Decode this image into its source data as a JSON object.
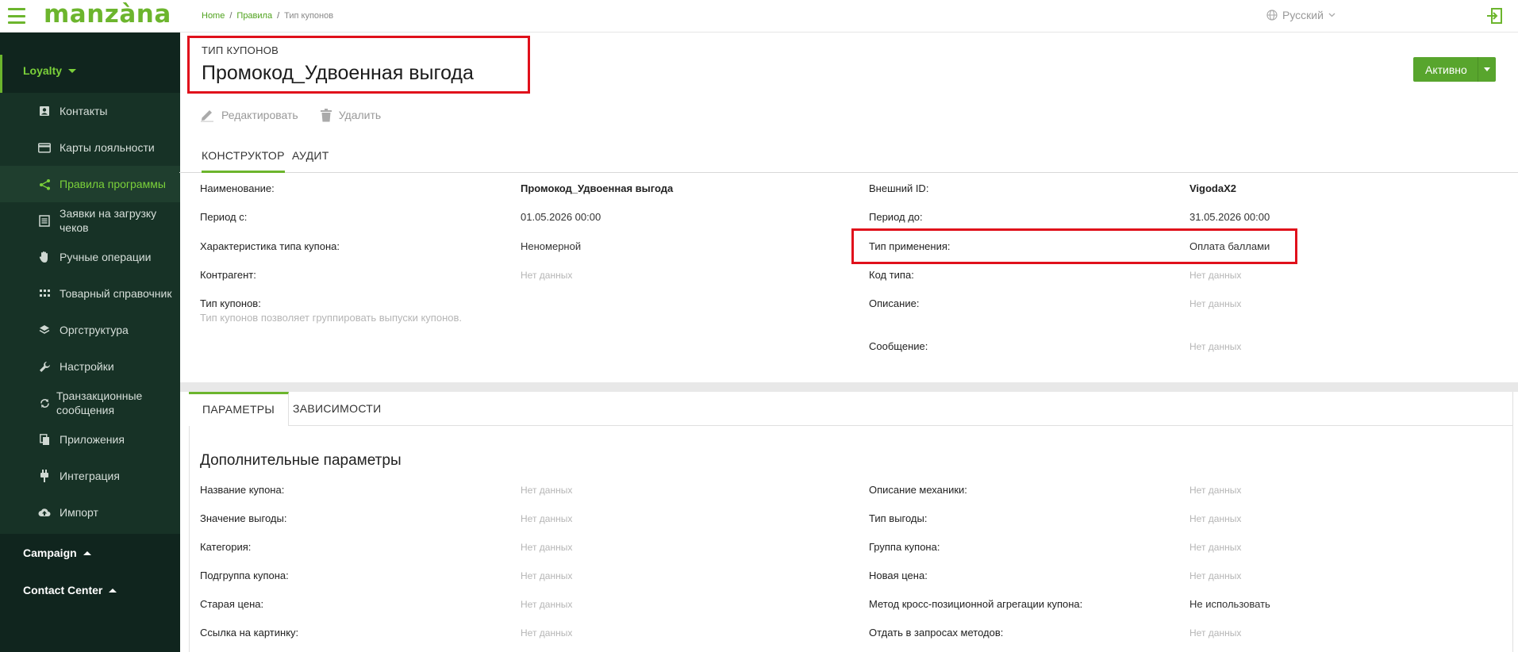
{
  "app": {
    "logo": "manzàna",
    "breadcrumb": {
      "home": "Home",
      "sep1": "/",
      "rules": "Правила",
      "sep2": "/",
      "current": "Тип купонов"
    },
    "language": "Русский"
  },
  "sidebar": {
    "loyalty": "Loyalty",
    "items": [
      {
        "label": "Контакты",
        "icon": "contact-card-icon"
      },
      {
        "label": "Карты лояльности",
        "icon": "credit-card-icon"
      },
      {
        "label": "Правила программы",
        "icon": "share-nodes-icon"
      },
      {
        "label": "Заявки на загрузку чеков",
        "icon": "receipt-list-icon"
      },
      {
        "label": "Ручные операции",
        "icon": "hand-icon"
      },
      {
        "label": "Товарный справочник",
        "icon": "grid-icon"
      },
      {
        "label": "Оргструктура",
        "icon": "layers-icon"
      },
      {
        "label": "Настройки",
        "icon": "wrench-icon"
      },
      {
        "label": "Транзакционные сообщения",
        "icon": "sync-icon"
      },
      {
        "label": "Приложения",
        "icon": "files-icon"
      },
      {
        "label": "Интеграция",
        "icon": "plug-icon"
      },
      {
        "label": "Импорт",
        "icon": "cloud-upload-icon"
      }
    ],
    "campaign": "Campaign",
    "contact_center": "Contact Center"
  },
  "header": {
    "type_label": "ТИП КУПОНОВ",
    "title": "Промокод_Удвоенная выгода",
    "status": "Активно"
  },
  "actions": {
    "edit": "Редактировать",
    "delete": "Удалить"
  },
  "tabs": {
    "constructor": "КОНСТРУКТОР",
    "audit": "АУДИТ"
  },
  "details": {
    "name_label": "Наименование:",
    "name_value": "Промокод_Удвоенная выгода",
    "period_from_label": "Период с:",
    "period_from_value": "01.05.2026 00:00",
    "char_label": "Характеристика типа купона:",
    "char_value": "Неномерной",
    "counterparty_label": "Контрагент:",
    "counterparty_value": "Нет данных",
    "coupon_type_label": "Тип купонов:",
    "coupon_type_hint": "Тип купонов позволяет группировать выпуски купонов.",
    "external_id_label": "Внешний ID:",
    "external_id_value": "VigodaX2",
    "period_to_label": "Период до:",
    "period_to_value": "31.05.2026 00:00",
    "apply_type_label": "Тип применения:",
    "apply_type_value": "Оплата баллами",
    "type_code_label": "Код типа:",
    "type_code_value": "Нет данных",
    "description_label": "Описание:",
    "description_value": "Нет данных",
    "message_label": "Сообщение:",
    "message_value": "Нет данных"
  },
  "tabs2": {
    "params": "ПАРАМЕТРЫ",
    "deps": "ЗАВИСИМОСТИ"
  },
  "params": {
    "section_title": "Дополнительные параметры",
    "left": [
      {
        "label": "Название купона:",
        "value": "Нет данных"
      },
      {
        "label": "Значение выгоды:",
        "value": "Нет данных"
      },
      {
        "label": "Категория:",
        "value": "Нет данных"
      },
      {
        "label": "Подгруппа купона:",
        "value": "Нет данных"
      },
      {
        "label": "Старая цена:",
        "value": "Нет данных"
      },
      {
        "label": "Ссылка на картинку:",
        "value": "Нет данных"
      }
    ],
    "right": [
      {
        "label": "Описание механики:",
        "value": "Нет данных"
      },
      {
        "label": "Тип выгоды:",
        "value": "Нет данных"
      },
      {
        "label": "Группа купона:",
        "value": "Нет данных"
      },
      {
        "label": "Новая цена:",
        "value": "Нет данных"
      },
      {
        "label": "Метод кросс-позиционной агрегации купона:",
        "value": "Не использовать"
      },
      {
        "label": "Отдать в запросах методов:",
        "value": "Нет данных"
      }
    ]
  }
}
